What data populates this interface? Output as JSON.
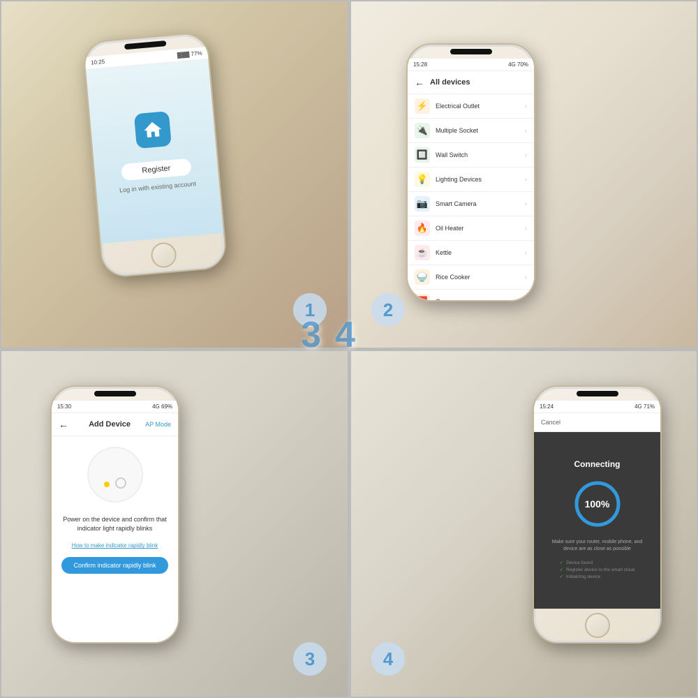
{
  "steps": {
    "one": "1",
    "two": "2",
    "three": "3",
    "four": "4"
  },
  "cell1": {
    "register_btn": "Register",
    "login_link": "Log in with existing account"
  },
  "cell2": {
    "title": "All devices",
    "devices": [
      {
        "name": "Electrical Outlet",
        "color": "#f5a623",
        "icon": "⚡"
      },
      {
        "name": "Multiple Socket",
        "color": "#4CAF50",
        "icon": "🔌"
      },
      {
        "name": "Wall Switch",
        "color": "#4CAF50",
        "icon": "🔲"
      },
      {
        "name": "Lighting Devices",
        "color": "#f5a623",
        "icon": "💡"
      },
      {
        "name": "Smart Camera",
        "color": "#3399cc",
        "icon": "📷"
      },
      {
        "name": "Oil Heater",
        "color": "#e74c3c",
        "icon": "🔥"
      },
      {
        "name": "Kettle",
        "color": "#e74c3c",
        "icon": "☕"
      },
      {
        "name": "Rice Cooker",
        "color": "#e67e22",
        "icon": "🍚"
      },
      {
        "name": "Oven",
        "color": "#e67e22",
        "icon": "🟥"
      }
    ]
  },
  "cell3": {
    "title": "Add Device",
    "mode": "AP Mode",
    "instruction": "Power on the device and confirm that indicator light rapidly blinks",
    "blink_link": "How to make indicator rapidly blink",
    "confirm_btn": "Confirm indicator rapidly blink"
  },
  "cell4": {
    "cancel": "Cancel",
    "connecting": "Connecting",
    "percent": "100%",
    "description": "Make sure your router, mobile phone, and device are as close as possible",
    "steps": [
      "Device found",
      "Register device to the smart cloud",
      "Initializing device"
    ]
  }
}
